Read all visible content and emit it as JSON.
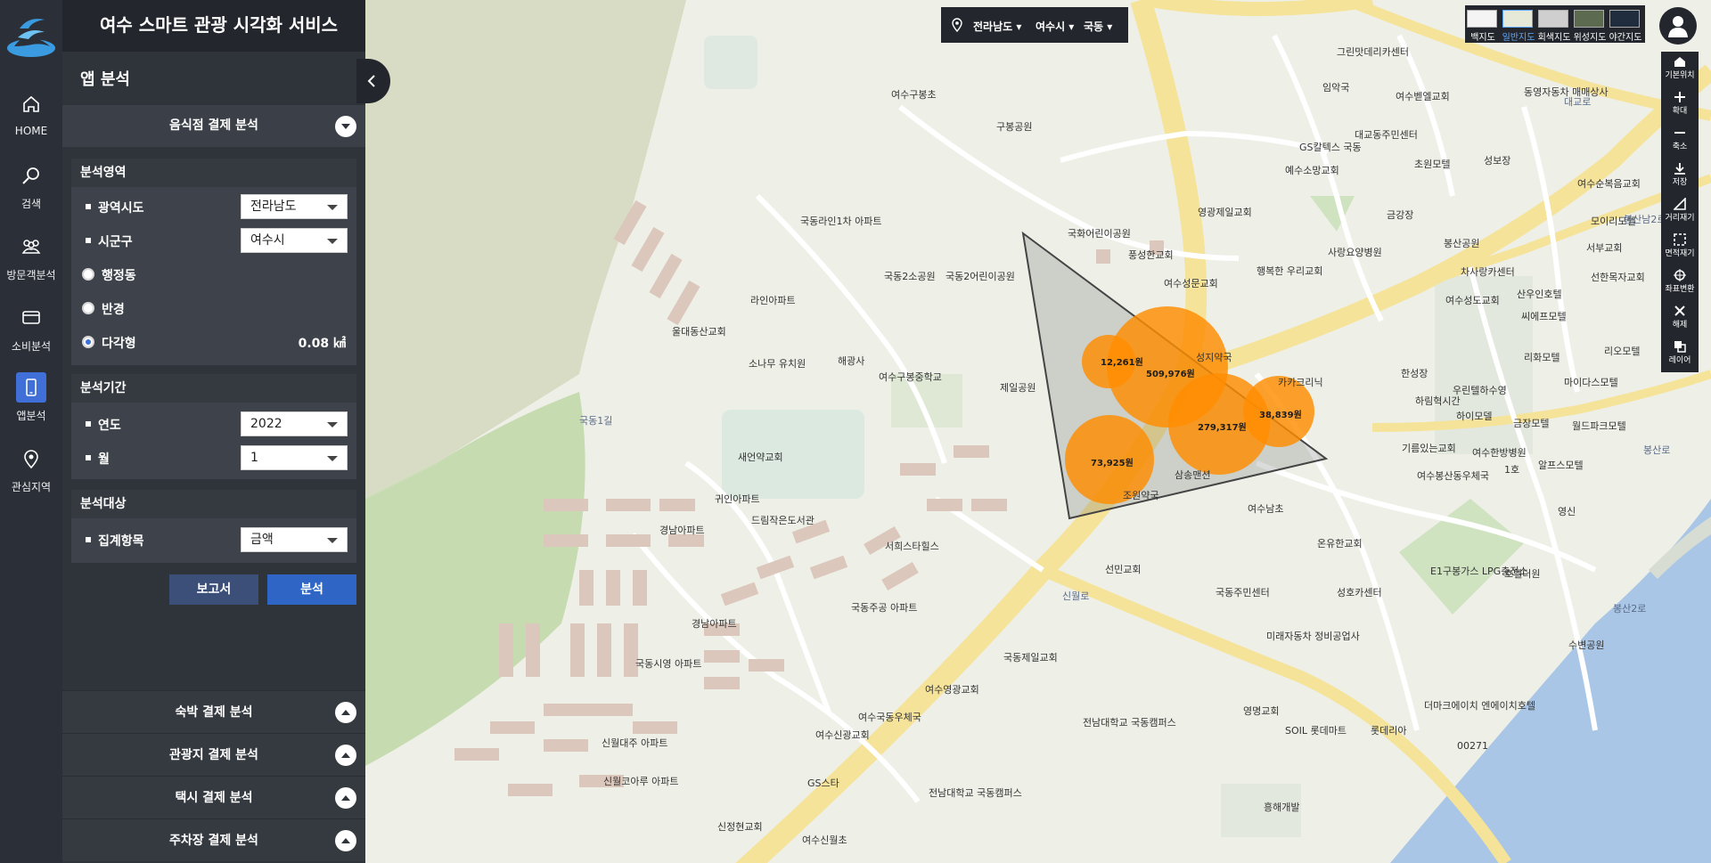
{
  "app": {
    "title": "여수 스마트 관광 시각화 서비스"
  },
  "nav": [
    {
      "id": "home",
      "label": "HOME",
      "icon": "home-icon"
    },
    {
      "id": "search",
      "label": "검색",
      "icon": "search-icon"
    },
    {
      "id": "visitors",
      "label": "방문객분석",
      "icon": "users-icon"
    },
    {
      "id": "consumption",
      "label": "소비분석",
      "icon": "card-icon"
    },
    {
      "id": "app",
      "label": "앱분석",
      "icon": "phone-icon",
      "active": true
    },
    {
      "id": "interest",
      "label": "관심지역",
      "icon": "pin-icon"
    }
  ],
  "panel": {
    "title": "앱 분석",
    "section_title": "음식점 결제 분석",
    "area": {
      "title": "분석영역",
      "province_label": "광역시도",
      "province_value": "전라남도",
      "city_label": "시군구",
      "city_value": "여수시",
      "radio_dong": "행정동",
      "radio_radius": "반경",
      "radio_polygon": "다각형",
      "polygon_area": "0.08 ㎢"
    },
    "period": {
      "title": "분석기간",
      "year_label": "연도",
      "year_value": "2022",
      "month_label": "월",
      "month_value": "1"
    },
    "target": {
      "title": "분석대상",
      "item_label": "집계항목",
      "item_value": "금액"
    },
    "buttons": {
      "report": "보고서",
      "analyze": "분석"
    },
    "accordions": [
      "숙박 결제 분석",
      "관광지 결제 분석",
      "택시 결제 분석",
      "주차장 결제 분석"
    ]
  },
  "region_bar": {
    "province": "전라남도",
    "city": "여수시",
    "dong": "국동"
  },
  "map_types": [
    "백지도",
    "일반지도",
    "회색지도",
    "위성지도",
    "야간지도"
  ],
  "map_type_selected": "일반지도",
  "tools": [
    "기본위치",
    "확대",
    "축소",
    "저장",
    "거리재기",
    "면적재기",
    "좌표변환",
    "해제",
    "레이어"
  ],
  "bubbles": [
    {
      "label": "12,261원",
      "value": 12261
    },
    {
      "label": "509,976원",
      "value": 509976
    },
    {
      "label": "279,317원",
      "value": 279317
    },
    {
      "label": "38,839원",
      "value": 38839
    },
    {
      "label": "73,925원",
      "value": 73925
    }
  ],
  "map_labels": [
    "그린맛데리카센터",
    "임악국",
    "여수벧엘교회",
    "동영자동차 매매상사",
    "대교동주민센터",
    "GS칼텍스 국동",
    "예수소망교회",
    "초원모텔",
    "성보장",
    "여수순복음교회",
    "모이리모텔",
    "서부교회",
    "봉산공원",
    "금강장",
    "차사랑카센터",
    "선한목자교회",
    "여수구봉초",
    "구봉공원",
    "국화어린이공원",
    "풍성한교회",
    "영광제일교회",
    "사랑요양병원",
    "행복한 우리교회",
    "여수성문교회",
    "여수성도교회",
    "산우인호텔",
    "씨에프모텔",
    "국동라인1차 아파트",
    "라인아파트",
    "국동2소공원",
    "국동2어린이공원",
    "울대동산교회",
    "소나무 유치원",
    "해광사",
    "여수구봉중학교",
    "제일공원",
    "성지약국",
    "카카크리닉",
    "한성장",
    "우린텔하수영",
    "리화모텔",
    "마이다스모텔",
    "리오모텔",
    "하림혁시간",
    "하이모델",
    "금장모텔",
    "월드파크모텔",
    "여수한방병원",
    "알프스모텔",
    "기름있는교회",
    "여수봉산동우체국",
    "1호",
    "영신",
    "새언약교회",
    "귀인아파트",
    "드림작은도서관",
    "경남아파트",
    "서희스타힐스",
    "삼송맨션",
    "조원약국",
    "여수남초",
    "온유한교회",
    "선민교회",
    "국동주민센터",
    "성호카센터",
    "E1구봉가스 LPG충전소",
    "호텔더원",
    "국동주공 아파트",
    "경남아파트",
    "국동시영 아파트",
    "국동제일교회",
    "전남대학교 국동캠퍼스",
    "여수영광교회",
    "미래자동차 정비공업사",
    "영명교회",
    "SOIL 롯데마트",
    "롯데리아",
    "더마크에이치 엔에이치호텔",
    "00271",
    "수변공원",
    "신월대주 아파트",
    "신월코아루 아파트",
    "여수국동우체국",
    "여수신광교회",
    "GS스타",
    "전남대학교 국동캠퍼스",
    "신정현교회",
    "여수신월초",
    "흥해개발",
    "대교로",
    "봉산남2로",
    "봉산로",
    "신월로",
    "국동1길",
    "봉산2로"
  ]
}
